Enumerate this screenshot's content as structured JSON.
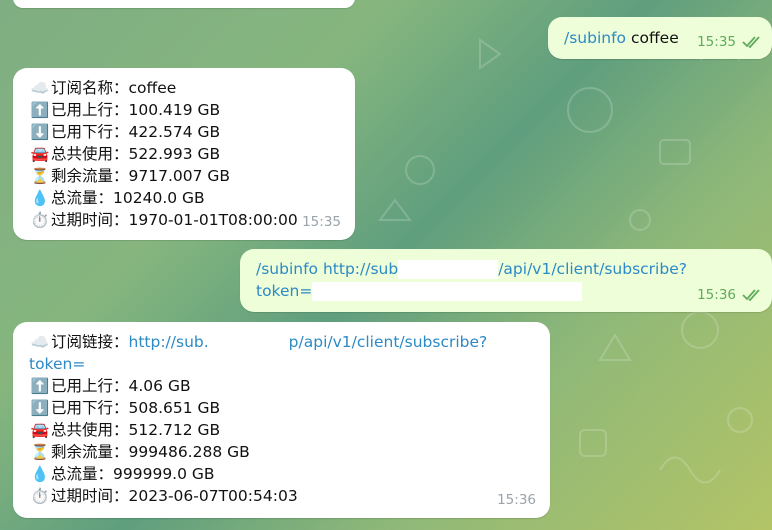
{
  "messages": [
    {
      "out_text": "coffee",
      "command": "/subinfo",
      "time": "15:35"
    },
    {
      "lines": [
        {
          "icon": "☁️",
          "label": "订阅名称：",
          "value": "coffee"
        },
        {
          "icon": "⬆️",
          "label": "已用上行：",
          "value": "100.419 GB"
        },
        {
          "icon": "⬇️",
          "label": "已用下行：",
          "value": "422.574 GB"
        },
        {
          "icon": "🚘",
          "label": "总共使用：",
          "value": "522.993 GB"
        },
        {
          "icon": "⏳",
          "label": "剩余流量：",
          "value": "9717.007 GB"
        },
        {
          "icon": "💧",
          "label": "总流量：",
          "value": "10240.0 GB"
        },
        {
          "icon": "⏱️",
          "label": "过期时间：",
          "value": "1970-01-01T08:00:00"
        }
      ],
      "time": "15:35"
    },
    {
      "command": "/subinfo",
      "url_line1": "http://sub",
      "url_line1b": "/api/v1/client/subscribe?",
      "url_line2": "token=",
      "time": "15:36"
    },
    {
      "link_label": "订阅链接：",
      "link_part1": "http://sub.",
      "link_part2": "p/api/v1/client/subscribe?",
      "link_part3": "token=",
      "lines": [
        {
          "icon": "⬆️",
          "label": "已用上行：",
          "value": "4.06 GB"
        },
        {
          "icon": "⬇️",
          "label": "已用下行：",
          "value": "508.651 GB"
        },
        {
          "icon": "🚘",
          "label": "总共使用：",
          "value": "512.712 GB"
        },
        {
          "icon": "⏳",
          "label": "剩余流量：",
          "value": "999486.288 GB"
        },
        {
          "icon": "💧",
          "label": "总流量：",
          "value": "999999.0 GB"
        },
        {
          "icon": "⏱️",
          "label": "过期时间：",
          "value": "2023-06-07T00:54:03"
        }
      ],
      "cloud_icon": "☁️",
      "time": "15:36"
    }
  ],
  "colors": {
    "link": "#2c8ac6",
    "outgoing_bubble": "#eefed9",
    "incoming_bubble": "#ffffff",
    "check": "#5fab5b"
  }
}
